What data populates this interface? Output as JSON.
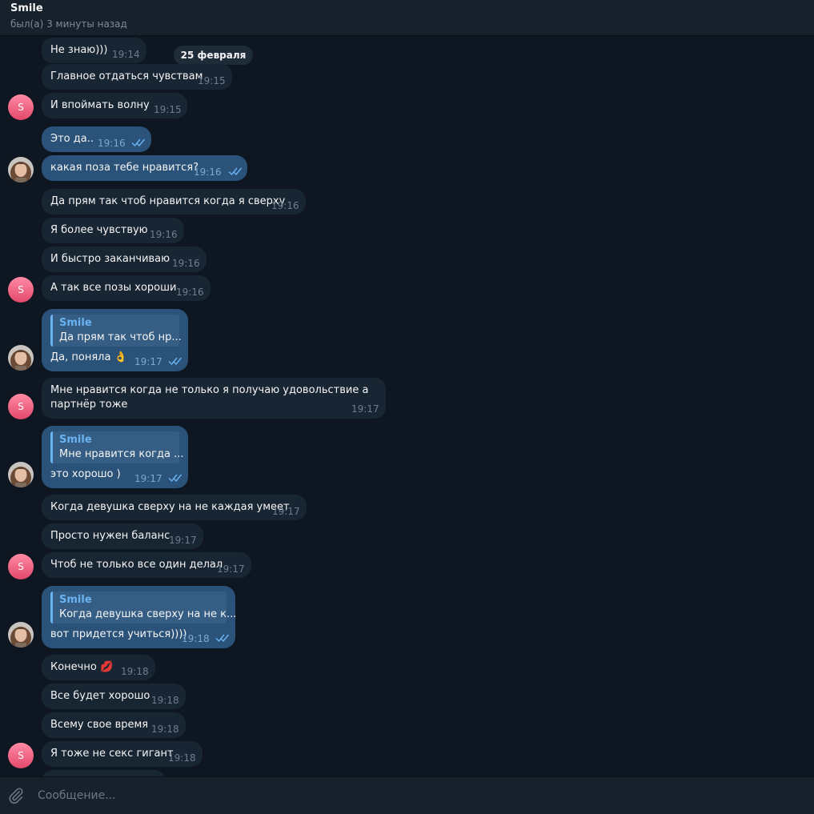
{
  "header": {
    "title": "Smile",
    "status": "был(а) 3 минуты назад"
  },
  "date_separator": "25 февраля",
  "contact_initial": "S",
  "colors": {
    "background": "#0e1621",
    "incoming_bubble": "#182533",
    "outgoing_bubble": "#2b5278",
    "accent": "#6ab3f3",
    "avatar": "#e3496b"
  },
  "messages": [
    {
      "text": "Не знаю)))",
      "time": "19:14",
      "dir": "in"
    },
    {
      "text": "Главное отдаться чувствам",
      "time": "19:15",
      "dir": "in"
    },
    {
      "text": "И впоймать волну",
      "time": "19:15",
      "dir": "in"
    },
    {
      "text": "Это да..",
      "time": "19:16",
      "dir": "out",
      "read": true
    },
    {
      "text": "какая поза тебе нравится?",
      "time": "19:16",
      "dir": "out",
      "read": true
    },
    {
      "text": "Да прям так чтоб нравится когда я сверху",
      "time": "19:16",
      "dir": "in"
    },
    {
      "text": "Я более чувствую",
      "time": "19:16",
      "dir": "in"
    },
    {
      "text": "И быстро заканчиваю",
      "time": "19:16",
      "dir": "in"
    },
    {
      "text": "А так все позы хороши",
      "time": "19:16",
      "dir": "in"
    },
    {
      "text": "Да, поняла 👌",
      "time": "19:17",
      "dir": "out",
      "read": true,
      "reply_to": {
        "name": "Smile",
        "text": "Да прям так чтоб нр..."
      }
    },
    {
      "text_line1": "Мне нравится когда не только я получаю удовольствие а",
      "text_line2": "партнёр тоже",
      "time": "19:17",
      "dir": "in"
    },
    {
      "text": "это хорошо )",
      "time": "19:17",
      "dir": "out",
      "read": true,
      "reply_to": {
        "name": "Smile",
        "text": "Мне нравится когда ..."
      }
    },
    {
      "text": "Когда девушка сверху на не каждая умеет",
      "time": "19:17",
      "dir": "in"
    },
    {
      "text": "Просто нужен баланс",
      "time": "19:17",
      "dir": "in"
    },
    {
      "text": "Чтоб не только все один делал",
      "time": "19:17",
      "dir": "in"
    },
    {
      "text": "вот придется учиться))))",
      "time": "19:18",
      "dir": "out",
      "read": true,
      "reply_to": {
        "name": "Smile",
        "text": "Когда девушка сверху на не к..."
      }
    },
    {
      "text": "Конечно 💋",
      "time": "19:18",
      "dir": "in"
    },
    {
      "text": "Все будет хорошо",
      "time": "19:18",
      "dir": "in"
    },
    {
      "text": "Всему свое время",
      "time": "19:18",
      "dir": "in"
    },
    {
      "text": "Я тоже не секс гигант",
      "time": "19:18",
      "dir": "in"
    }
  ],
  "composer": {
    "placeholder": "Сообщение..."
  },
  "icons": {
    "attach": "paperclip-icon",
    "read_receipt": "double-check-icon"
  }
}
